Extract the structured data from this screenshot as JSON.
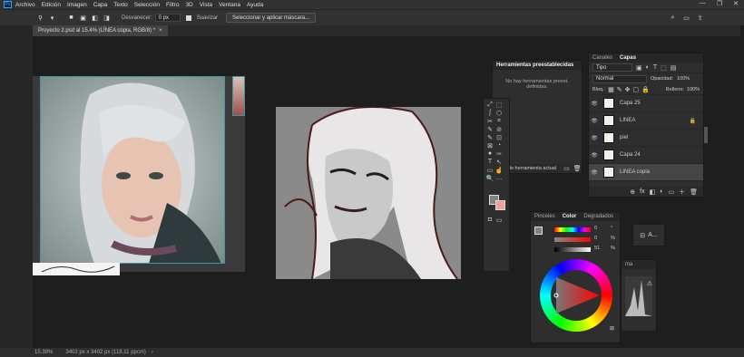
{
  "app": {
    "logo": "Ps"
  },
  "menu": [
    "Archivo",
    "Edición",
    "Imagen",
    "Capa",
    "Texto",
    "Selección",
    "Filtro",
    "3D",
    "Vista",
    "Ventana",
    "Ayuda"
  ],
  "window_controls": [
    "—",
    "❐",
    "✕"
  ],
  "options": {
    "desvanecer_label": "Desvanecer:",
    "desvanecer_value": "0 px",
    "suavizar_label": "Suavizar",
    "mask_button": "Seleccionar y aplicar máscara..."
  },
  "document": {
    "tab_title": "Proyecto 2.psd al 15.4% (LÍNEA copia, RGB/8) *",
    "close": "×"
  },
  "status": {
    "zoom": "15.39%",
    "size": "3402 px x 3402 px (118,11 ppcm)"
  },
  "presets_panel": {
    "title": "Herramientas preestablecidas",
    "empty_text": "No hay herramientas preest. definidas.",
    "only_current": "Solo herramienta actual"
  },
  "layers_panel": {
    "tabs": [
      "Canales",
      "Capas"
    ],
    "filter_label": "Tipo",
    "blend_mode": "Normal",
    "opacity_label": "Opacidad:",
    "opacity_value": "100%",
    "lock_label": "Bloq.:",
    "fill_label": "Relleno:",
    "fill_value": "100%",
    "layers": [
      {
        "name": "Capa 25",
        "locked": false,
        "selected": false
      },
      {
        "name": "LINEA",
        "locked": true,
        "selected": false
      },
      {
        "name": "piel",
        "locked": false,
        "selected": false
      },
      {
        "name": "Capa 24",
        "locked": false,
        "selected": false
      },
      {
        "name": "LINEA copia",
        "locked": false,
        "selected": true
      }
    ],
    "footer_icons": [
      "⊕",
      "fx",
      "◧",
      "◐",
      "▭",
      "＋",
      "🗑"
    ]
  },
  "color_panel": {
    "tabs": [
      "Pinceles",
      "Color",
      "Degradados"
    ],
    "sliders": [
      {
        "label": "H",
        "value": "0",
        "unit": "°"
      },
      {
        "label": "S",
        "value": "0",
        "unit": "%"
      },
      {
        "label": "B",
        "value": "51",
        "unit": "%"
      }
    ],
    "hue_indicator_angle": 0
  },
  "colors": {
    "accent": "#31a8ff",
    "foreground": "#828282",
    "background": "#f0a09a"
  },
  "mini_panel": {
    "label": "A..."
  },
  "histogram_label": "ma",
  "tools": [
    "⤢",
    "⬚",
    "ʃ",
    "⬡",
    "✂",
    "⌗",
    "✎",
    "⊘",
    "✎",
    "⊡",
    "⊠",
    "◔",
    "●",
    "✑",
    "T",
    "↖",
    "▭",
    "☝",
    "🔍",
    "…"
  ]
}
